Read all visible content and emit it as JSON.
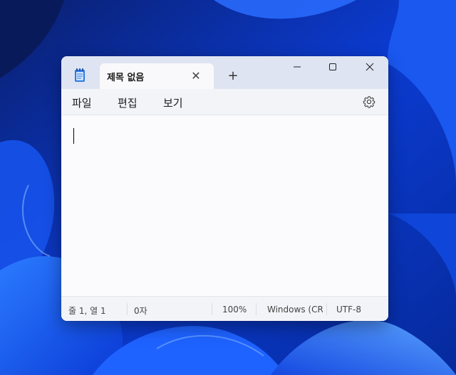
{
  "tab": {
    "title": "제목 없음",
    "close_glyph": "✕",
    "new_tab_glyph": "+"
  },
  "menu": {
    "file": "파일",
    "edit": "편집",
    "view": "보기"
  },
  "status": {
    "position": "줄 1, 열 1",
    "chars": "0자",
    "zoom": "100%",
    "line_ending": "Windows (CRLF)",
    "encoding": "UTF-8"
  },
  "icons": {
    "app": "notepad-icon",
    "settings": "gear-icon",
    "minimize": "minimize-icon",
    "maximize": "maximize-icon",
    "close": "close-icon"
  },
  "colors": {
    "titlebar": "#dfe4f2",
    "editor": "#fbfbfd",
    "accent": "#1a5cff"
  }
}
